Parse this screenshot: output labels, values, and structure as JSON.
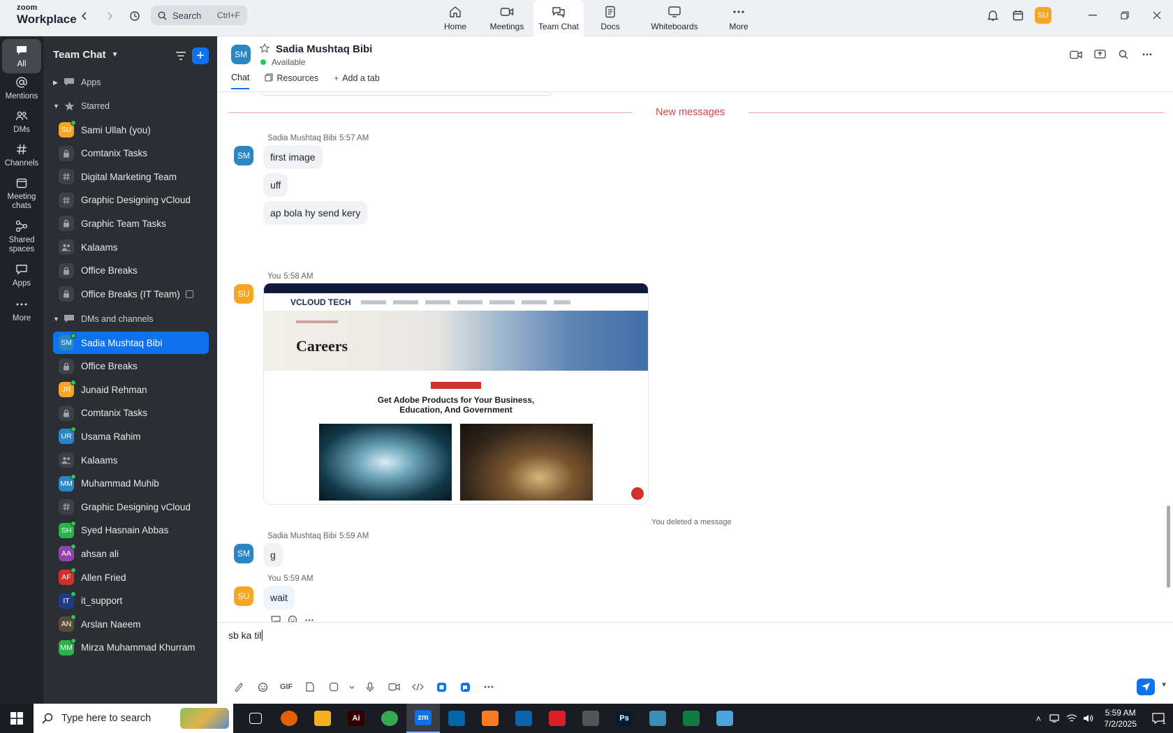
{
  "brand": {
    "line1": "zoom",
    "line2": "Workplace"
  },
  "topbar": {
    "search_label": "Search",
    "search_shortcut": "Ctrl+F",
    "tabs": [
      {
        "label": "Home",
        "icon": "home-icon"
      },
      {
        "label": "Meetings",
        "icon": "video-camera-icon"
      },
      {
        "label": "Team Chat",
        "icon": "chat-bubble-icon"
      },
      {
        "label": "Docs",
        "icon": "document-icon"
      },
      {
        "label": "Whiteboards",
        "icon": "whiteboard-icon"
      },
      {
        "label": "More",
        "icon": "ellipsis-icon"
      }
    ],
    "user_initials": "SU"
  },
  "rail": [
    {
      "label": "All",
      "icon": "chat-icon"
    },
    {
      "label": "Mentions",
      "icon": "at-sign-icon"
    },
    {
      "label": "DMs",
      "icon": "people-icon"
    },
    {
      "label": "Channels",
      "icon": "hash-icon"
    },
    {
      "label": "Meeting chats",
      "icon": "calendar-icon"
    },
    {
      "label": "Shared spaces",
      "icon": "shared-spaces-icon"
    },
    {
      "label": "Apps",
      "icon": "apps-icon"
    },
    {
      "label": "More",
      "icon": "ellipsis-icon"
    }
  ],
  "sidebar": {
    "title": "Team Chat",
    "apps_label": "Apps",
    "starred_label": "Starred",
    "starred": [
      {
        "label": "Sami Ullah (you)",
        "initials": "SU",
        "color": "#f5a623"
      },
      {
        "label": "Comtanix Tasks",
        "type": "lock"
      },
      {
        "label": "Digital Marketing Team",
        "type": "hash"
      },
      {
        "label": "Graphic Designing vCloud",
        "type": "hash"
      },
      {
        "label": "Graphic Team Tasks",
        "type": "lock"
      },
      {
        "label": "Kalaams",
        "type": "group"
      },
      {
        "label": "Office Breaks",
        "type": "lock"
      },
      {
        "label": "Office Breaks (IT Team)",
        "type": "lock"
      }
    ],
    "dms_label": "DMs and channels",
    "dms": [
      {
        "label": "Sadia Mushtaq Bibi",
        "initials": "SM",
        "color": "#2b86c5"
      },
      {
        "label": "Office Breaks",
        "type": "lock"
      },
      {
        "label": "Junaid Rehman",
        "initials": "JR",
        "color": "#f5a623"
      },
      {
        "label": "Comtanix Tasks",
        "type": "lock"
      },
      {
        "label": "Usama Rahim",
        "initials": "UR",
        "color": "#2b86c5"
      },
      {
        "label": "Kalaams",
        "type": "group"
      },
      {
        "label": "Muhammad Muhib",
        "initials": "MM",
        "color": "#2b86c5"
      },
      {
        "label": "Graphic Designing vCloud",
        "type": "hash"
      },
      {
        "label": "Syed Hasnain Abbas",
        "initials": "SH",
        "color": "#2bb24c"
      },
      {
        "label": "ahsan ali",
        "initials": "AA",
        "color": "#8e44ad"
      },
      {
        "label": "Allen Fried",
        "initials": "AF",
        "color": "#d2302c"
      },
      {
        "label": "it_support",
        "initials": "IT",
        "color": "#1f3c88"
      },
      {
        "label": "Arslan Naeem",
        "initials": "AN",
        "color": "#5a4a3a"
      },
      {
        "label": "Mirza Muhammad Khurram",
        "initials": "MM",
        "color": "#2bb24c"
      }
    ]
  },
  "channel": {
    "initials": "SM",
    "name": "Sadia Mushtaq Bibi",
    "status": "Available",
    "tabs": {
      "chat": "Chat",
      "resources": "Resources",
      "add": "Add a tab"
    }
  },
  "messages": {
    "new_label": "New messages",
    "group1": {
      "sender": "Sadia Mushtaq Bibi",
      "time": "5:57 AM",
      "initials": "SM",
      "texts": [
        "first image",
        "uff",
        "ap bola hy send kery"
      ]
    },
    "group2": {
      "sender": "You",
      "time": "5:58 AM",
      "initials": "SU"
    },
    "shot": {
      "logo": "VCLOUD TECH",
      "hero_title": "Careers",
      "headline_1": "Get Adobe Products for Your Business,",
      "headline_2": "Education, And Government"
    },
    "deleted": "You deleted a message",
    "group3": {
      "sender": "Sadia Mushtaq Bibi",
      "time": "5:59 AM",
      "initials": "SM",
      "text": "g"
    },
    "group4": {
      "sender": "You",
      "time": "5:59 AM",
      "initials": "SU",
      "text": "wait"
    }
  },
  "composer": {
    "draft": "sb ka til",
    "gif_label": "GIF"
  },
  "taskbar": {
    "search_placeholder": "Type here to search",
    "time": "5:59 AM",
    "date": "7/2/2025",
    "notification_count": "1",
    "apps": [
      {
        "name": "task-view",
        "label": "",
        "color": "#1b1c22"
      },
      {
        "name": "firefox",
        "label": "",
        "color": "#e66000"
      },
      {
        "name": "file-explorer",
        "label": "",
        "color": "#f2b01e"
      },
      {
        "name": "illustrator",
        "label": "Ai",
        "color": "#330000"
      },
      {
        "name": "chrome",
        "label": "",
        "color": "#34a853"
      },
      {
        "name": "zoom",
        "label": "zm",
        "color": "#0e72ed"
      },
      {
        "name": "vscode",
        "label": "",
        "color": "#0065a9"
      },
      {
        "name": "xampp",
        "label": "",
        "color": "#fb7a24"
      },
      {
        "name": "outlook",
        "label": "",
        "color": "#0a64ad"
      },
      {
        "name": "creative-cloud",
        "label": "",
        "color": "#da1f26"
      },
      {
        "name": "inkscape",
        "label": "",
        "color": "#555"
      },
      {
        "name": "photoshop",
        "label": "Ps",
        "color": "#001e36"
      },
      {
        "name": "app-diamond",
        "label": "",
        "color": "#3a8fb7"
      },
      {
        "name": "excel",
        "label": "",
        "color": "#107c41"
      },
      {
        "name": "notepad",
        "label": "",
        "color": "#4aa3df"
      }
    ]
  },
  "colors": {
    "accent": "#0e72ed",
    "online": "#2bc45a",
    "new_messages": "#d64545"
  }
}
